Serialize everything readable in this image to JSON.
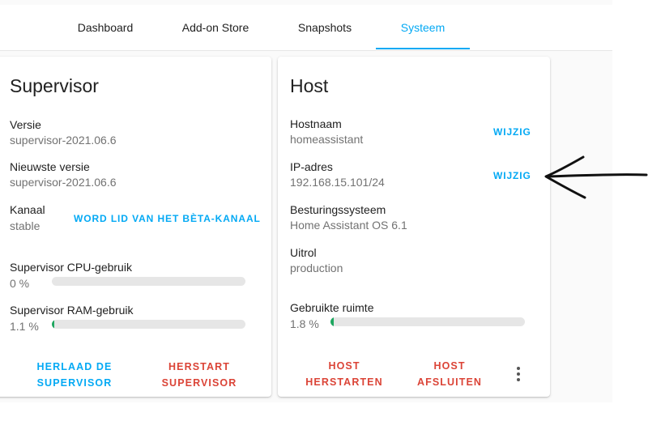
{
  "tabs": [
    {
      "label": "Dashboard"
    },
    {
      "label": "Add-on Store"
    },
    {
      "label": "Snapshots"
    },
    {
      "label": "Systeem"
    }
  ],
  "supervisor": {
    "title": "Supervisor",
    "version_label": "Versie",
    "version_value": "supervisor-2021.06.6",
    "latest_label": "Nieuwste versie",
    "latest_value": "supervisor-2021.06.6",
    "channel_label": "Kanaal",
    "channel_value": "stable",
    "channel_action": "WORD LID VAN HET BÈTA-KANAAL",
    "cpu_label": "Supervisor CPU-gebruik",
    "cpu_value": "0 %",
    "cpu_percent": 0,
    "ram_label": "Supervisor RAM-gebruik",
    "ram_value": "1.1 %",
    "ram_percent": 1.1,
    "reload_line1": "HERLAAD DE",
    "reload_line2": "SUPERVISOR",
    "restart_line1": "HERSTART",
    "restart_line2": "SUPERVISOR"
  },
  "host": {
    "title": "Host",
    "hostname_label": "Hostnaam",
    "hostname_value": "homeassistant",
    "hostname_action": "WIJZIG",
    "ip_label": "IP-adres",
    "ip_value": "192.168.15.101/24",
    "ip_action": "WIJZIG",
    "os_label": "Besturingssysteem",
    "os_value": "Home Assistant OS 6.1",
    "deployment_label": "Uitrol",
    "deployment_value": "production",
    "disk_label": "Gebruikte ruimte",
    "disk_value": "1.8 %",
    "disk_percent": 1.8,
    "restart_line1": "HOST",
    "restart_line2": "HERSTARTEN",
    "shutdown_line1": "HOST",
    "shutdown_line2": "AFSLUITEN"
  },
  "colors": {
    "accent": "#03a9f4",
    "danger": "#db4437",
    "bar_fill": "#1fa760"
  },
  "icons": {
    "menu": "kebab-menu-icon",
    "annotation": "hand-drawn-arrow-icon"
  }
}
